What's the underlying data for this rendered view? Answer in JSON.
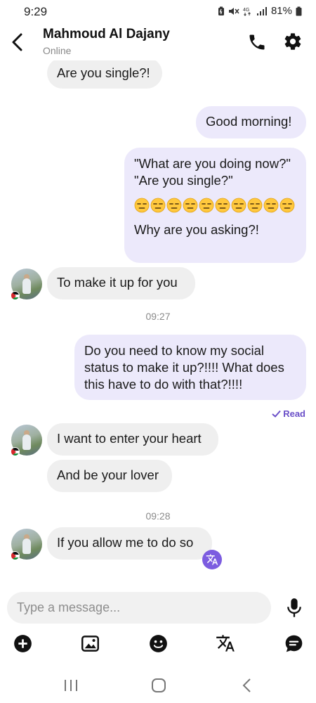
{
  "status_bar": {
    "time": "9:29",
    "battery": "81%"
  },
  "header": {
    "name": "Mahmoud Al Dajany",
    "presence": "Online"
  },
  "messages": [
    {
      "dir": "in",
      "text": "Are you single?!"
    },
    {
      "dir": "out",
      "text": "Good morning!"
    },
    {
      "dir": "out",
      "lines": [
        "\"What are you doing now?\"",
        "\"Are you single?\""
      ],
      "emoji": "😑",
      "emoji_count": 10,
      "closing": "Why are you asking?!"
    },
    {
      "dir": "in",
      "text": "To make it up for you"
    },
    {
      "dir": "out",
      "lines": [
        "Do you need to know my social",
        "status to make it up?!!!! What does",
        "this have to do with that?!!!!"
      ]
    },
    {
      "dir": "in",
      "text": "I want to enter your heart"
    },
    {
      "dir": "in",
      "text": "And be your lover"
    },
    {
      "dir": "in",
      "text": "If you allow me to do so"
    }
  ],
  "time_labels": [
    "09:27",
    "09:28"
  ],
  "read_label": "Read",
  "composer": {
    "placeholder": "Type a message..."
  },
  "colors": {
    "accent": "#7c5ce0",
    "outgoing_bubble": "#ece9fb",
    "incoming_bubble": "#efefef"
  },
  "icons": {
    "header": [
      "back-arrow",
      "phone",
      "gear"
    ],
    "toolbar": [
      "add-circle",
      "image",
      "emoji",
      "translate",
      "chat-bubble"
    ],
    "navbar": [
      "recents",
      "home",
      "back"
    ]
  }
}
